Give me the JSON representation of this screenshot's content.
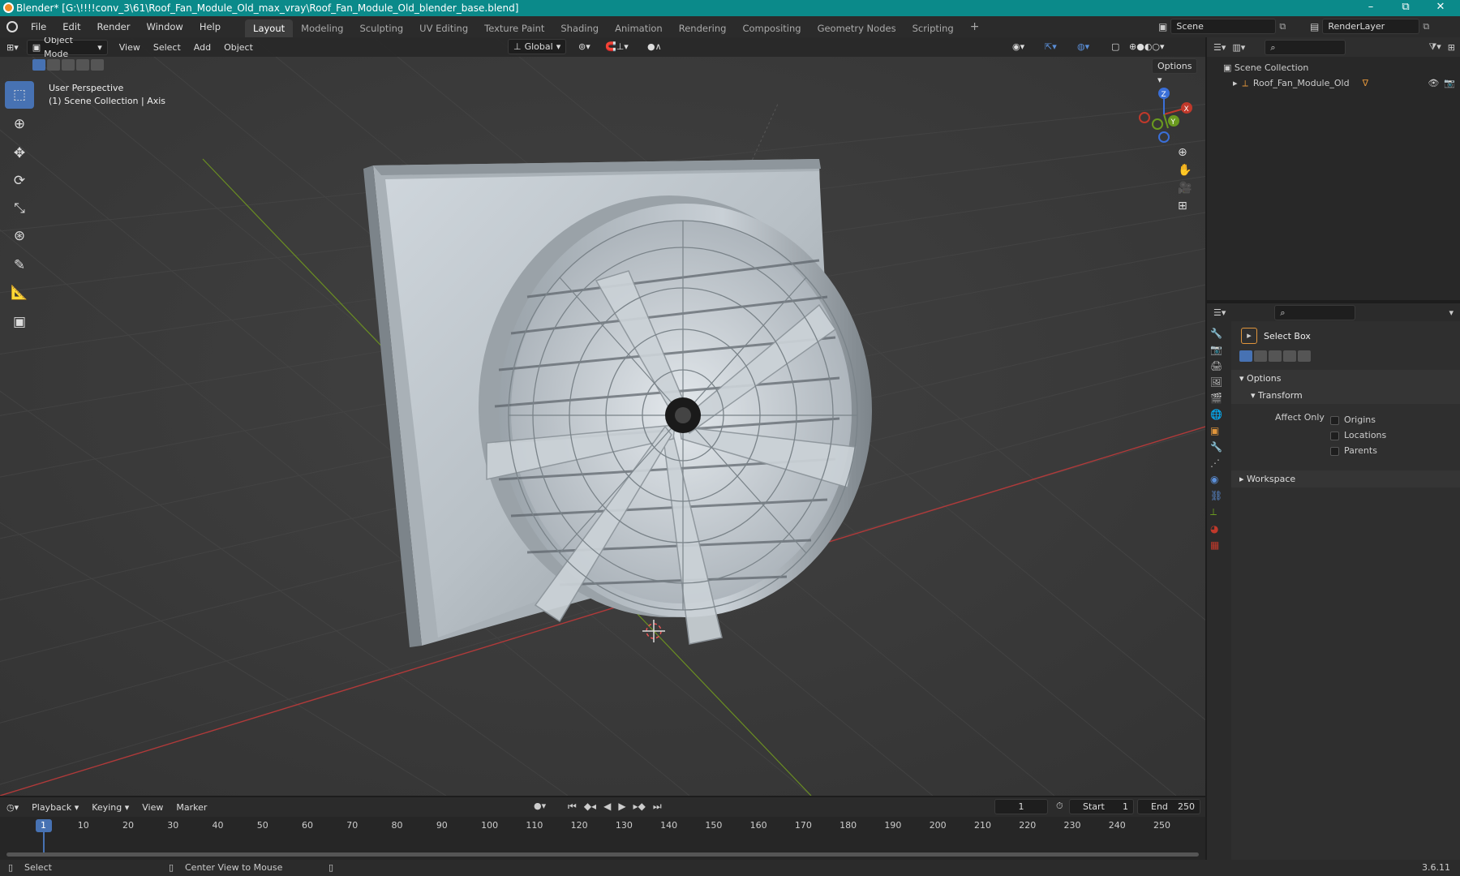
{
  "window": {
    "title": "Blender* [G:\\!!!!conv_3\\61\\Roof_Fan_Module_Old_max_vray\\Roof_Fan_Module_Old_blender_base.blend]",
    "minimize": "–",
    "maximize": "⧉",
    "close": "✕"
  },
  "menus": [
    "File",
    "Edit",
    "Render",
    "Window",
    "Help"
  ],
  "workspaces": [
    "Layout",
    "Modeling",
    "Sculpting",
    "UV Editing",
    "Texture Paint",
    "Shading",
    "Animation",
    "Rendering",
    "Compositing",
    "Geometry Nodes",
    "Scripting"
  ],
  "add_workspace": "+",
  "scene": {
    "name": "Scene",
    "view_layer": "RenderLayer"
  },
  "viewport_header": {
    "mode": "Object Mode",
    "view": "View",
    "select": "Select",
    "add": "Add",
    "object": "Object",
    "orientation": "Global",
    "options": "Options"
  },
  "viewport": {
    "perspective": "User Perspective",
    "collection_info": "(1) Scene Collection | Axis",
    "gizmo": {
      "x": "X",
      "y": "Y",
      "z": "Z"
    }
  },
  "outliner": {
    "root": "Scene Collection",
    "items": [
      {
        "name": "Roof_Fan_Module_Old"
      }
    ]
  },
  "properties": {
    "tool_name": "Select Box",
    "options_label": "Options",
    "transform_label": "Transform",
    "affect_only_label": "Affect Only",
    "checks": [
      "Origins",
      "Locations",
      "Parents"
    ],
    "workspace_label": "Workspace"
  },
  "timeline": {
    "playback": "Playback",
    "keying": "Keying",
    "view": "View",
    "marker": "Marker",
    "current_frame": "1",
    "start_label": "Start",
    "start": "1",
    "end_label": "End",
    "end": "250",
    "ticks": [
      "1",
      "10",
      "20",
      "30",
      "40",
      "50",
      "60",
      "70",
      "80",
      "90",
      "100",
      "110",
      "120",
      "130",
      "140",
      "150",
      "160",
      "170",
      "180",
      "190",
      "200",
      "210",
      "220",
      "230",
      "240",
      "250"
    ]
  },
  "status": {
    "select": "Select",
    "center_view": "Center View to Mouse",
    "version": "3.6.11"
  },
  "colors": {
    "title_bar": "#0b8a8a",
    "accent": "#4772b3",
    "axis_x": "#c0392b",
    "axis_y": "#6a9a1f",
    "axis_z": "#3a6fd8"
  }
}
